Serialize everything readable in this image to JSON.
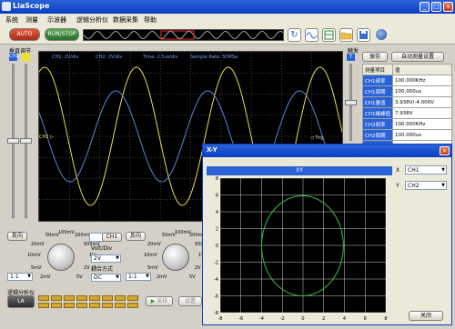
{
  "app": {
    "title": "LiaScope"
  },
  "menu": [
    "系统",
    "测量",
    "示波器",
    "逻辑分析仪",
    "数据采集",
    "帮助"
  ],
  "toolbar": {
    "auto": "AUTO",
    "run_stop": "RUN/STOP"
  },
  "vert_adjust_label": "垂直调节",
  "trig_label": "触发",
  "scope_info": {
    "ch1": "CH1: 2V/div",
    "ch2": "CH2: 2V/div",
    "time": "Time: 2.5us/div",
    "sample": "Sample Rate: 50MSa"
  },
  "markers": {
    "ch1": "CH1",
    "ch2": "CH2 ▷",
    "trig": "◁ Trig",
    "t": "T"
  },
  "right_panel": {
    "save": "保存",
    "auto_measure": "自动测量设置",
    "headers": [
      "测量项目",
      "值"
    ],
    "rows": [
      [
        "CH1频率",
        "100.000KHz"
      ],
      [
        "CH1周期",
        "100.000us"
      ],
      [
        "CH1量值",
        "3.938V/-4.000V"
      ],
      [
        "CH1峰峰值",
        "7.938V"
      ],
      [
        "CH2频率",
        "100.000KHz"
      ],
      [
        "CH2周期",
        "100.000us"
      ],
      [
        "CH2量值",
        "5.938V/-6.000V"
      ]
    ]
  },
  "ch1_panel": {
    "invert": "反向",
    "ch_label": "CH1",
    "volt_div": "Volt/Div",
    "volt_val": "2V",
    "coupling_label": "耦合方式",
    "coupling_val": "DC",
    "probe": "1:1",
    "dial": [
      "50mV",
      "100mV",
      "200mV",
      "20mV",
      "500mV",
      "10mV",
      "1V",
      "5mV",
      "2V",
      "2mV",
      "5V"
    ]
  },
  "ch2_panel": {
    "invert": "反向",
    "dial": [
      "50mV",
      "100mV",
      "200mV",
      "20mV",
      "500mV",
      "10mV",
      "1V",
      "5mV",
      "2V",
      "2mV",
      "5V"
    ],
    "probe": "1:1"
  },
  "logic": {
    "label": "逻辑分析仪",
    "la": "LA",
    "collect": "采样",
    "settings": "设置"
  },
  "xy_window": {
    "title": "X-Y",
    "plot_title": "XY",
    "x_label": "X",
    "x_val": "CH1",
    "y_label": "Y",
    "y_val": "CH2",
    "close": "关闭",
    "x_ticks": [
      "-8",
      "-6",
      "-4",
      "-2",
      "0",
      "2",
      "4",
      "6",
      "8"
    ],
    "y_ticks": [
      "8",
      "6",
      "4",
      "2",
      "0",
      "-2",
      "-4",
      "-6",
      "-8"
    ]
  },
  "colors": {
    "ch1": "#e6e04a",
    "ch2": "#5b86d8",
    "xy": "#35c43a",
    "grid": "#7a7a7a",
    "accent": "#0a3ec4"
  },
  "chart_data": {
    "type": "scatter",
    "title": "XY",
    "xlim": [
      -8,
      8
    ],
    "ylim": [
      -8,
      8
    ],
    "grid": true,
    "curve": "ellipse",
    "x_range": [
      -4.0,
      3.9
    ],
    "y_range": [
      -6.0,
      5.9
    ]
  }
}
